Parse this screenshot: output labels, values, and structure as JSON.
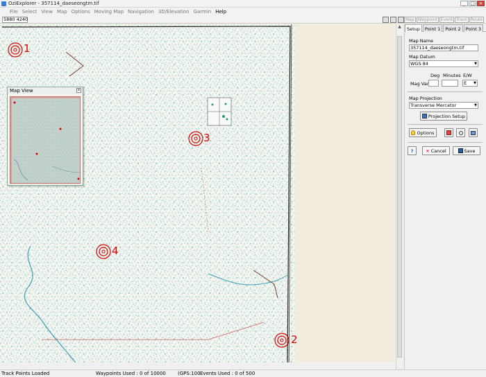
{
  "window": {
    "title": "OziExplorer - 357114_daeseongtm.tif",
    "min_glyph": "_",
    "max_glyph": "□",
    "close_glyph": "×"
  },
  "menu": [
    "File",
    "Select",
    "View",
    "Map",
    "Options",
    "Moving Map",
    "Navigation",
    "3D/Elevation",
    "Garmin",
    "Help"
  ],
  "toolbar": {
    "coords": "5880  4240",
    "tabs": [
      "Map",
      "Waypoint",
      "Event",
      "Track",
      "Route"
    ]
  },
  "map": {
    "markers": [
      {
        "label": "1"
      },
      {
        "label": "2"
      },
      {
        "label": "3"
      },
      {
        "label": "4"
      }
    ],
    "colors": {
      "background": "#f3ede0",
      "frame": "#222222",
      "texture": "#2c8f80",
      "marker": "#d60000"
    }
  },
  "map_view": {
    "title": "Map View",
    "close_glyph": "x"
  },
  "panel": {
    "tabs": [
      "Setup",
      "Point 1",
      "Point 2",
      "Point 3"
    ],
    "map_name_label": "Map Name",
    "map_name_value": "357114_daeseongtm.tif",
    "map_datum_label": "Map Datum",
    "map_datum_value": "WGS 84",
    "deg_label": "Deg",
    "minutes_label": "Minutes",
    "ew_label": "E/W",
    "mag_var_label": "Mag Var",
    "mag_var_deg": "",
    "mag_var_min": "",
    "mag_var_ew": "E",
    "projection_label": "Map Projection",
    "projection_value": "Transverse Mercator",
    "projection_setup_label": "Projection Setup",
    "options_label": "Options",
    "help_glyph": "?",
    "cancel_label": "Cancel",
    "save_label": "Save"
  },
  "status": {
    "track": "Track Points Loaded",
    "waypoints": "Waypoints Used : 0 of 10000",
    "gps": "(GPS:100",
    "events": "Events Used : 0 of 500"
  }
}
